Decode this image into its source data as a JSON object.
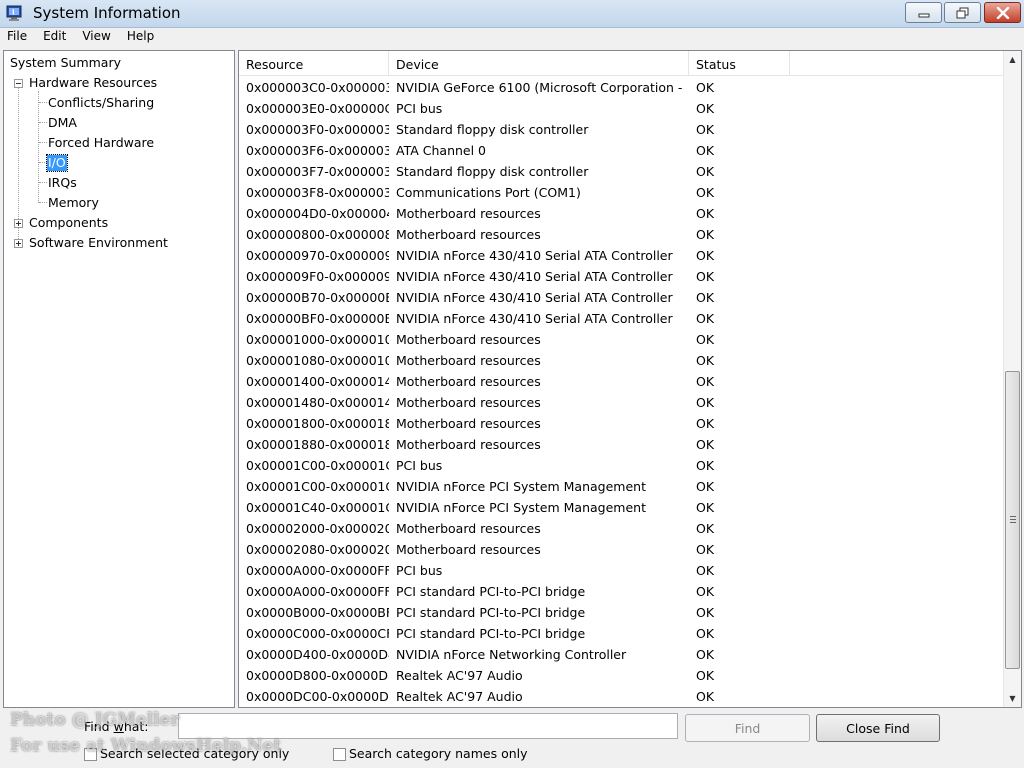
{
  "window": {
    "title": "System Information"
  },
  "colors": {
    "selection": "#3399ff",
    "close_button": "#c2402a",
    "title_bar": "#c3d7ec"
  },
  "menu": [
    "File",
    "Edit",
    "View",
    "Help"
  ],
  "tree": {
    "system_summary": "System Summary",
    "hardware_resources": "Hardware Resources",
    "conflicts_sharing": "Conflicts/Sharing",
    "dma": "DMA",
    "forced_hardware": "Forced Hardware",
    "io": "I/O",
    "irqs": "IRQs",
    "memory": "Memory",
    "components": "Components",
    "software_environment": "Software Environment"
  },
  "table": {
    "columns": [
      "Resource",
      "Device",
      "Status"
    ],
    "rows": [
      [
        "0x000003C0-0x000003...",
        "NVIDIA GeForce 6100 (Microsoft Corporation - ...",
        "OK"
      ],
      [
        "0x000003E0-0x00000C...",
        "PCI bus",
        "OK"
      ],
      [
        "0x000003F0-0x000003F5",
        "Standard floppy disk controller",
        "OK"
      ],
      [
        "0x000003F6-0x000003F6",
        "ATA Channel 0",
        "OK"
      ],
      [
        "0x000003F7-0x000003F7",
        "Standard floppy disk controller",
        "OK"
      ],
      [
        "0x000003F8-0x000003FF",
        "Communications Port (COM1)",
        "OK"
      ],
      [
        "0x000004D0-0x000004...",
        "Motherboard resources",
        "OK"
      ],
      [
        "0x00000800-0x0000087F",
        "Motherboard resources",
        "OK"
      ],
      [
        "0x00000970-0x000009...",
        "NVIDIA nForce 430/410 Serial ATA Controller",
        "OK"
      ],
      [
        "0x000009F0-0x000009F7",
        "NVIDIA nForce 430/410 Serial ATA Controller",
        "OK"
      ],
      [
        "0x00000B70-0x00000B...",
        "NVIDIA nForce 430/410 Serial ATA Controller",
        "OK"
      ],
      [
        "0x00000BF0-0x00000BF3",
        "NVIDIA nForce 430/410 Serial ATA Controller",
        "OK"
      ],
      [
        "0x00001000-0x0000107F",
        "Motherboard resources",
        "OK"
      ],
      [
        "0x00001080-0x000010FF",
        "Motherboard resources",
        "OK"
      ],
      [
        "0x00001400-0x0000147F",
        "Motherboard resources",
        "OK"
      ],
      [
        "0x00001480-0x000014FF",
        "Motherboard resources",
        "OK"
      ],
      [
        "0x00001800-0x0000187F",
        "Motherboard resources",
        "OK"
      ],
      [
        "0x00001880-0x000018FF",
        "Motherboard resources",
        "OK"
      ],
      [
        "0x00001C00-0x00001C...",
        "PCI bus",
        "OK"
      ],
      [
        "0x00001C00-0x00001C...",
        "NVIDIA nForce PCI System Management",
        "OK"
      ],
      [
        "0x00001C40-0x00001C...",
        "NVIDIA nForce PCI System Management",
        "OK"
      ],
      [
        "0x00002000-0x0000207F",
        "Motherboard resources",
        "OK"
      ],
      [
        "0x00002080-0x000020FF",
        "Motherboard resources",
        "OK"
      ],
      [
        "0x0000A000-0x0000FFFF",
        "PCI bus",
        "OK"
      ],
      [
        "0x0000A000-0x0000FFFF",
        "PCI standard PCI-to-PCI bridge",
        "OK"
      ],
      [
        "0x0000B000-0x0000BFFF",
        "PCI standard PCI-to-PCI bridge",
        "OK"
      ],
      [
        "0x0000C000-0x0000CFFF",
        "PCI standard PCI-to-PCI bridge",
        "OK"
      ],
      [
        "0x0000D400-0x0000D4...",
        "NVIDIA nForce Networking Controller",
        "OK"
      ],
      [
        "0x0000D800-0x0000D8...",
        "Realtek AC'97 Audio",
        "OK"
      ],
      [
        "0x0000DC00-0x0000D...",
        "Realtek AC'97 Audio",
        "OK"
      ]
    ]
  },
  "find": {
    "label": "Find what:",
    "value": "",
    "find_button": "Find",
    "close_find_button": "Close Find",
    "search_selected": "Search selected category only",
    "search_names": "Search category names only"
  },
  "watermark": {
    "line1": "Photo @ JGMeller",
    "line2": "For use at WindowsHelp.Net"
  }
}
